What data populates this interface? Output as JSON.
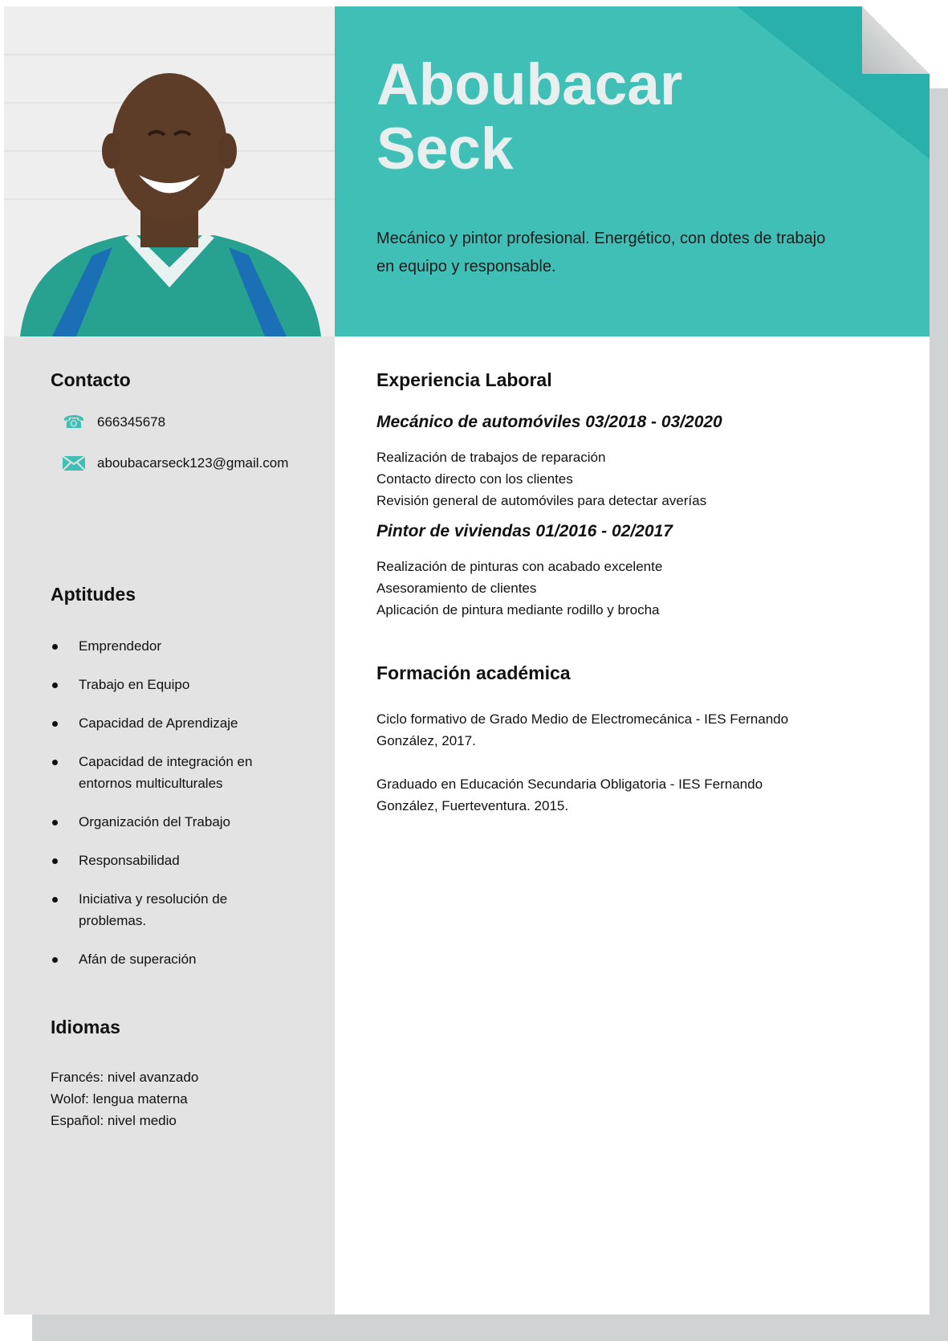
{
  "header": {
    "first_name": "Aboubacar",
    "last_name": "Seck",
    "summary": "Mecánico y pintor profesional. Energético, con dotes de trabajo en equipo y responsable."
  },
  "contact": {
    "heading": "Contacto",
    "phone": "666345678",
    "email": "aboubacarseck123@gmail.com",
    "phone_icon": "phone-icon",
    "email_icon": "envelope-icon"
  },
  "skills": {
    "heading": "Aptitudes",
    "items": [
      "Emprendedor",
      "Trabajo en Equipo",
      "Capacidad de Aprendizaje",
      "Capacidad de integración en entornos multiculturales",
      "Organización del Trabajo",
      "Responsabilidad",
      "Iniciativa y resolución de problemas.",
      "Afán de superación"
    ]
  },
  "languages": {
    "heading": "Idiomas",
    "items": [
      "Francés: nivel avanzado",
      "Wolof: lengua materna",
      "Español: nivel medio"
    ]
  },
  "experience": {
    "heading": "Experiencia Laboral",
    "jobs": [
      {
        "title": "Mecánico de automóviles 03/2018 - 03/2020",
        "tasks": [
          "Realización de trabajos de reparación",
          "Contacto directo con los clientes",
          "Revisión general de automóviles para detectar averías"
        ]
      },
      {
        "title": "Pintor de viviendas 01/2016 - 02/2017",
        "tasks": [
          "Realización de pinturas con acabado excelente",
          "Asesoramiento de clientes",
          "Aplicación de pintura mediante rodillo y brocha"
        ]
      }
    ]
  },
  "education": {
    "heading": "Formación académica",
    "entries": [
      "Ciclo formativo de Grado Medio de Electromecánica - IES Fernando González, 2017.",
      "Graduado en Educación Secundaria Obligatoria - IES Fernando González, Fuerteventura. 2015."
    ]
  },
  "colors": {
    "accent": "#40bfb7",
    "sidebar": "#e3e3e3"
  }
}
